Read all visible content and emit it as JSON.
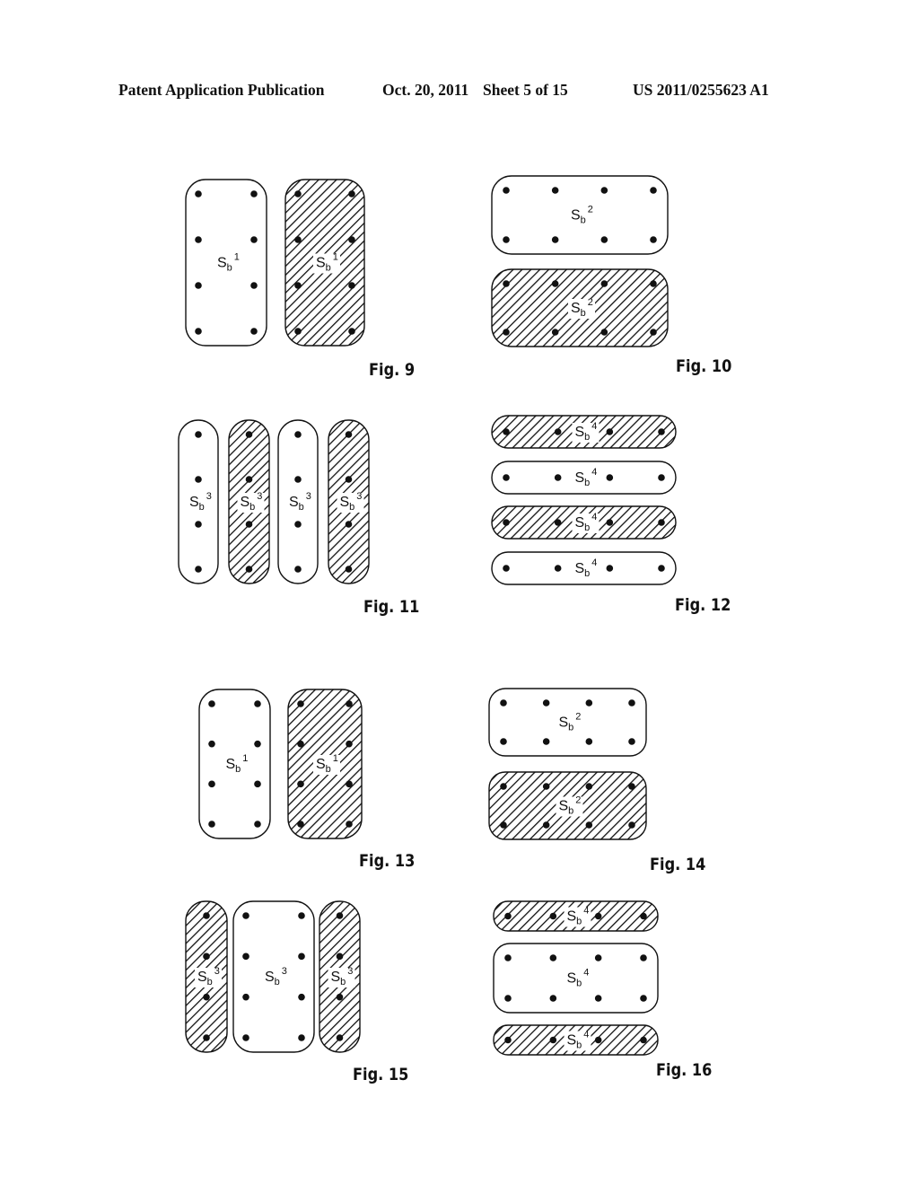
{
  "header": {
    "publication": "Patent Application Publication",
    "date": "Oct. 20, 2011",
    "sheet": "Sheet 5 of 15",
    "number": "US 2011/0255623 A1"
  },
  "figures": [
    {
      "id": "fig9",
      "label": "Fig. 9",
      "symbol": "S",
      "subscript": "b",
      "superscripts": [
        "1",
        "1"
      ],
      "hatched": [
        false,
        true
      ]
    },
    {
      "id": "fig10",
      "label": "Fig. 10",
      "symbol": "S",
      "subscript": "b",
      "superscripts": [
        "2",
        "2"
      ],
      "hatched": [
        false,
        true
      ]
    },
    {
      "id": "fig11",
      "label": "Fig. 11",
      "symbol": "S",
      "subscript": "b",
      "superscripts": [
        "3",
        "3",
        "3",
        "3"
      ],
      "hatched": [
        false,
        true,
        false,
        true
      ]
    },
    {
      "id": "fig12",
      "label": "Fig. 12",
      "symbol": "S",
      "subscript": "b",
      "superscripts": [
        "4",
        "4",
        "4",
        "4"
      ],
      "hatched": [
        true,
        false,
        true,
        false
      ]
    },
    {
      "id": "fig13",
      "label": "Fig. 13",
      "symbol": "S",
      "subscript": "b",
      "superscripts": [
        "1",
        "1"
      ],
      "hatched": [
        false,
        true
      ]
    },
    {
      "id": "fig14",
      "label": "Fig. 14",
      "symbol": "S",
      "subscript": "b",
      "superscripts": [
        "2",
        "2"
      ],
      "hatched": [
        false,
        true
      ]
    },
    {
      "id": "fig15",
      "label": "Fig. 15",
      "symbol": "S",
      "subscript": "b",
      "superscripts": [
        "3",
        "3",
        "3"
      ],
      "hatched": [
        true,
        false,
        true
      ]
    },
    {
      "id": "fig16",
      "label": "Fig. 16",
      "symbol": "S",
      "subscript": "b",
      "superscripts": [
        "4",
        "4",
        "4"
      ],
      "hatched": [
        true,
        false,
        true
      ]
    }
  ],
  "colors": {
    "ink": "#111111",
    "paper": "#ffffff"
  }
}
